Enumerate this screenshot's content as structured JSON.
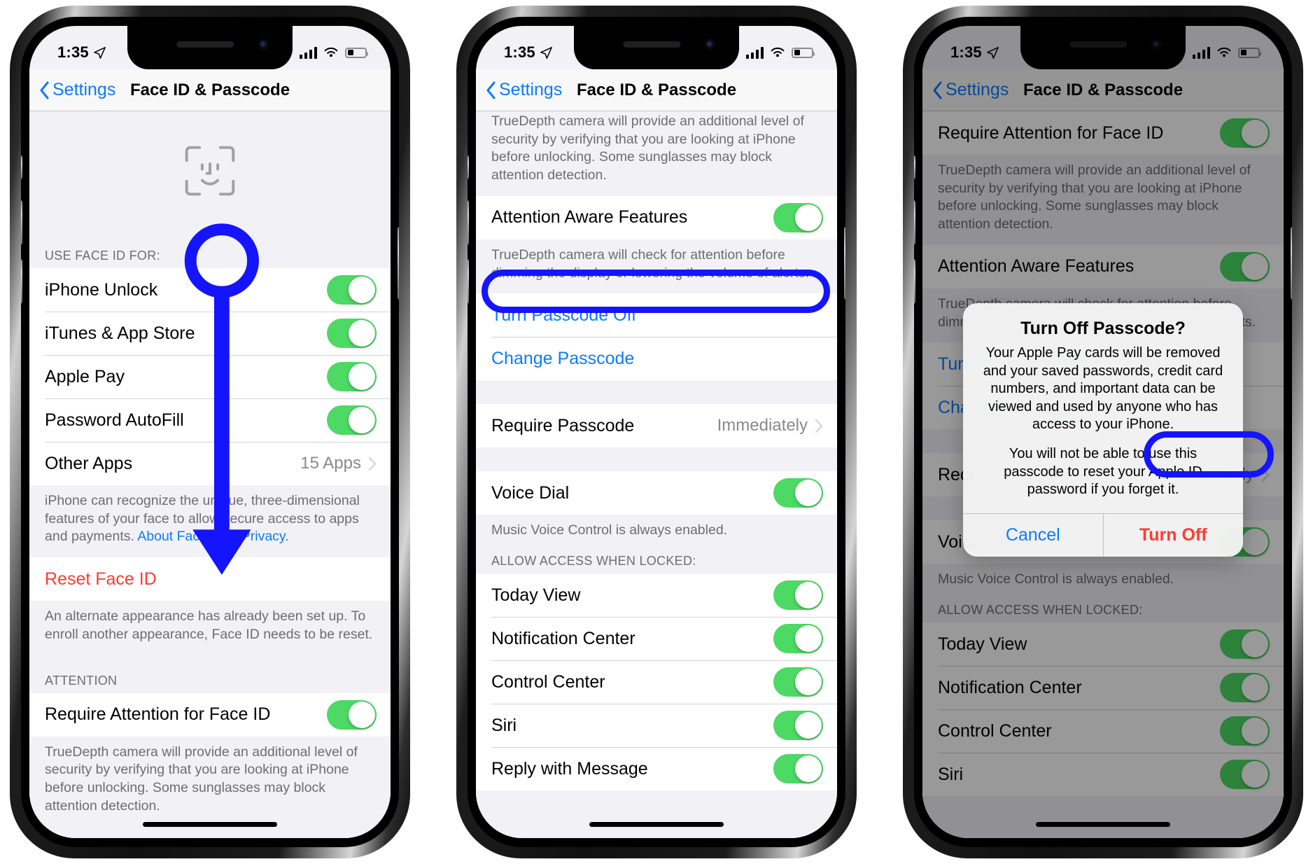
{
  "status_bar": {
    "time": "1:35",
    "location_icon": "location-arrow-icon",
    "signal_icon": "cellular-signal-icon",
    "wifi_icon": "wifi-icon",
    "battery_icon": "battery-icon"
  },
  "nav": {
    "back_label": "Settings",
    "title": "Face ID & Passcode",
    "back_icon": "chevron-left-icon"
  },
  "phone1": {
    "hero_icon": "face-id-icon",
    "section_use_face_id_header": "USE FACE ID FOR:",
    "rows": [
      {
        "label": "iPhone Unlock",
        "control": "toggle",
        "on": true
      },
      {
        "label": "iTunes & App Store",
        "control": "toggle",
        "on": true
      },
      {
        "label": "Apple Pay",
        "control": "toggle",
        "on": true
      },
      {
        "label": "Password AutoFill",
        "control": "toggle",
        "on": true
      },
      {
        "label": "Other Apps",
        "control": "disclosure",
        "value": "15 Apps"
      }
    ],
    "footer_face_id": "iPhone can recognize the unique, three-dimensional features of your face to allow secure access to apps and payments. ",
    "footer_face_id_link": "About Face ID & Privacy",
    "footer_face_id_tail": ".",
    "reset_row": "Reset Face ID",
    "footer_reset": "An alternate appearance has already been set up. To enroll another appearance, Face ID needs to be reset.",
    "section_attention_header": "ATTENTION",
    "attention_row": {
      "label": "Require Attention for Face ID",
      "control": "toggle",
      "on": true
    },
    "footer_attention": "TrueDepth camera will provide an additional level of security by verifying that you are looking at iPhone before unlocking. Some sunglasses may block attention detection.",
    "annotation": {
      "type": "arrow-down",
      "color": "#1414ff",
      "name": "scroll-down-annotation"
    }
  },
  "phone2": {
    "footer_attention_partial": "TrueDepth camera will provide an additional level of security by verifying that you are looking at iPhone before unlocking. Some sunglasses may block attention detection.",
    "attention_aware_row": {
      "label": "Attention Aware Features",
      "control": "toggle",
      "on": true
    },
    "footer_attention_aware": "TrueDepth camera will check for attention before dimming the display or lowering the volume of alerts.",
    "turn_passcode_off": "Turn Passcode Off",
    "change_passcode": "Change Passcode",
    "require_passcode": {
      "label": "Require Passcode",
      "value": "Immediately"
    },
    "voice_dial": {
      "label": "Voice Dial",
      "control": "toggle",
      "on": true
    },
    "footer_voice_dial": "Music Voice Control is always enabled.",
    "section_allow_access_header": "ALLOW ACCESS WHEN LOCKED:",
    "allow_rows": [
      {
        "label": "Today View",
        "on": true
      },
      {
        "label": "Notification Center",
        "on": true
      },
      {
        "label": "Control Center",
        "on": true
      },
      {
        "label": "Siri",
        "on": true
      },
      {
        "label": "Reply with Message",
        "on": true
      }
    ],
    "highlight": {
      "target": "Turn Passcode Off",
      "color": "#1414ff",
      "name": "turn-passcode-off-highlight"
    }
  },
  "phone3": {
    "require_attention_row": {
      "label": "Require Attention for Face ID",
      "control": "toggle",
      "on": true
    },
    "footer_attention": "TrueDepth camera will provide an additional level of security by verifying that you are looking at iPhone before unlocking. Some sunglasses may block attention detection.",
    "attention_aware_row": {
      "label": "Attention Aware Features",
      "control": "toggle",
      "on": true
    },
    "footer_attention_aware": "TrueDepth camera will check for attention before dimming the display or lowering the volume of alerts.",
    "turn_passcode_off": "Turn Passcode Off",
    "change_passcode": "Change Passcode",
    "require_passcode": {
      "label": "Require Passcode",
      "value": "Immediately"
    },
    "voice_dial": {
      "label": "Voice Dial",
      "control": "toggle",
      "on": true
    },
    "footer_voice_dial": "Music Voice Control is always enabled.",
    "section_allow_access_header": "ALLOW ACCESS WHEN LOCKED:",
    "allow_rows": [
      {
        "label": "Today View",
        "on": true
      },
      {
        "label": "Notification Center",
        "on": true
      },
      {
        "label": "Control Center",
        "on": true
      },
      {
        "label": "Siri",
        "on": true
      }
    ],
    "alert": {
      "title": "Turn Off Passcode?",
      "message_1": "Your Apple Pay cards will be removed and your saved passwords, credit card numbers, and important data can be viewed and used by anyone who has access to your iPhone.",
      "message_2": "You will not be able to use this passcode to reset your Apple ID password if you forget it.",
      "cancel_label": "Cancel",
      "confirm_label": "Turn Off",
      "confirm_color": "#ff3b30",
      "highlight_color": "#1414ff"
    }
  }
}
